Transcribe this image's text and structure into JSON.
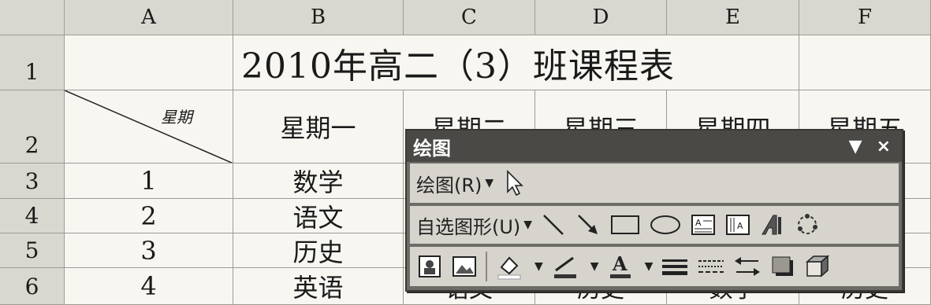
{
  "columns": [
    "A",
    "B",
    "C",
    "D",
    "E",
    "F"
  ],
  "rows": [
    "1",
    "2",
    "3",
    "4",
    "5",
    "6"
  ],
  "title": "2010年高二（3）班课程表",
  "corner_label": "星期",
  "day_headers": [
    "星期一",
    "星期二",
    "星期三",
    "星期四",
    "星期五"
  ],
  "periods": [
    "1",
    "2",
    "3",
    "4"
  ],
  "monday_subjects": [
    "数学",
    "语文",
    "历史",
    "英语"
  ],
  "row6_hidden": [
    "语文",
    "历史",
    "数学",
    "历史"
  ],
  "toolbar": {
    "title": "绘图",
    "close_label": "×",
    "menu_label": "绘图(R)",
    "autoshapes_label": "自选图形(U)"
  }
}
